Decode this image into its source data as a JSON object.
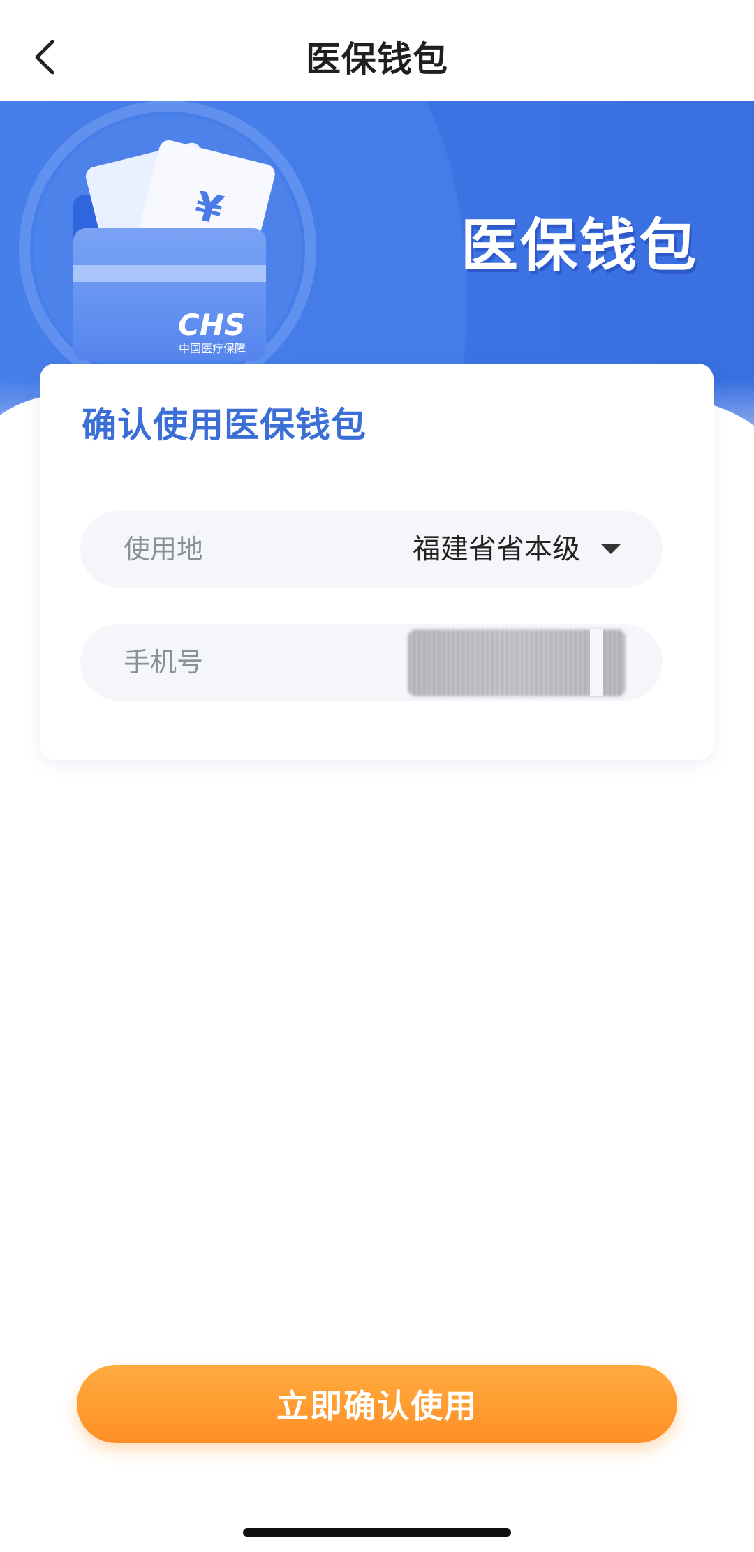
{
  "nav": {
    "title": "医保钱包"
  },
  "banner": {
    "title": "医保钱包",
    "logo_text": "CHS",
    "logo_subtext": "中国医疗保障"
  },
  "form": {
    "heading": "确认使用医保钱包",
    "location": {
      "label": "使用地",
      "value": "福建省省本级"
    },
    "phone": {
      "label": "手机号"
    }
  },
  "cta": {
    "label": "立即确认使用"
  },
  "colors": {
    "primary_blue": "#3b6fd6",
    "button_orange": "#ff9a2e"
  }
}
